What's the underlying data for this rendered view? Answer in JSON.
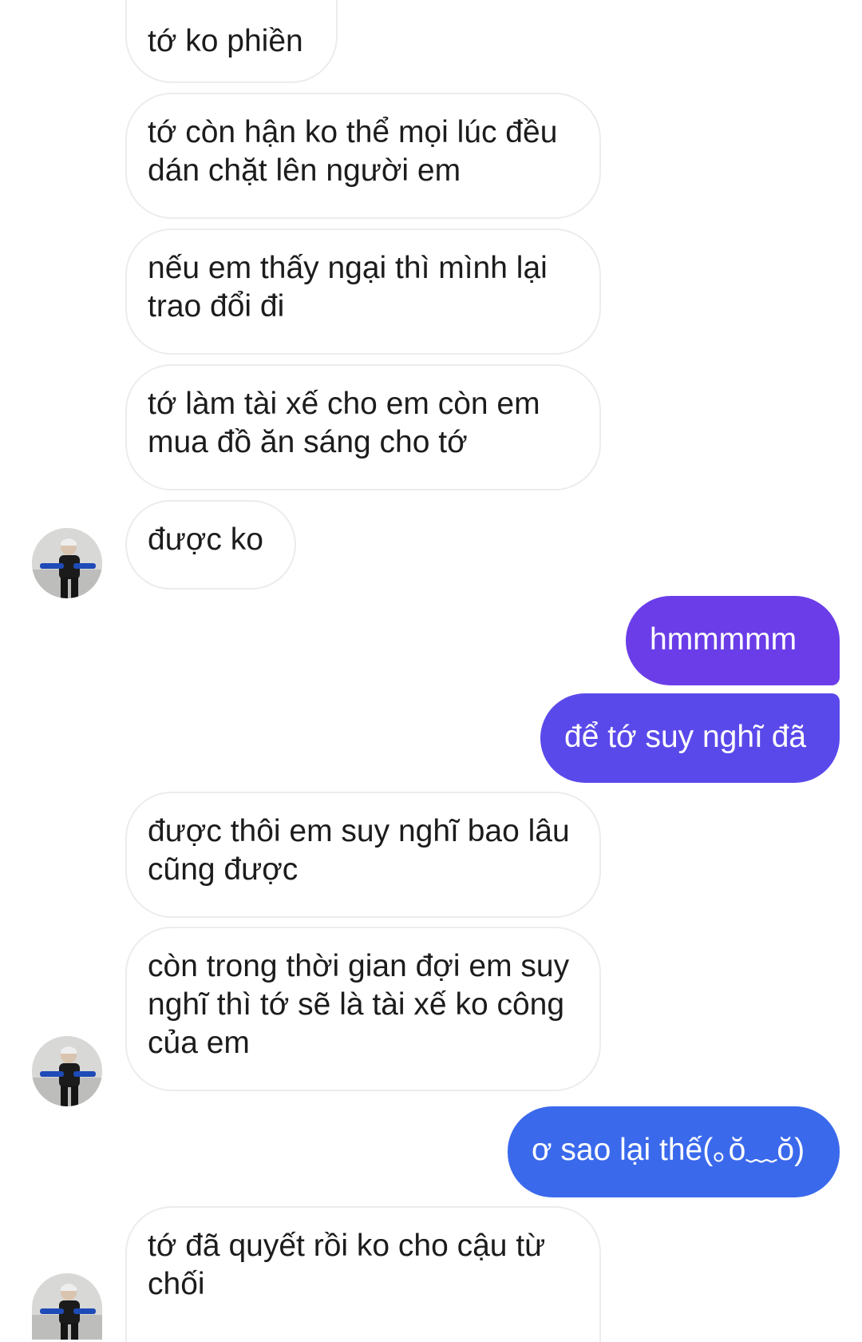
{
  "conversation": {
    "messages": [
      {
        "sender": "other",
        "text": "tớ ko phiền"
      },
      {
        "sender": "other",
        "text": "tớ còn hận ko thể mọi lúc đều dán chặt lên người em"
      },
      {
        "sender": "other",
        "text": "nếu em thấy ngại thì mình lại trao đổi đi"
      },
      {
        "sender": "other",
        "text": "tớ làm tài xế cho em còn em mua đồ ăn sáng cho tớ"
      },
      {
        "sender": "other",
        "text": "được ko"
      },
      {
        "sender": "me",
        "text": "hmmmmm"
      },
      {
        "sender": "me",
        "text": "để tớ suy nghĩ đã"
      },
      {
        "sender": "other",
        "text": "được thôi em suy nghĩ bao lâu cũng được"
      },
      {
        "sender": "other",
        "text": "còn trong thời gian đợi em suy nghĩ thì tớ sẽ là tài xế ko công của em"
      },
      {
        "sender": "me",
        "text": "ơ sao lại thế(｡ŏ﹏ŏ)"
      },
      {
        "sender": "other",
        "text": "tớ đã quyết rồi ko cho cậu từ chối"
      }
    ]
  },
  "colors": {
    "outgoing_top": "#6a3de8",
    "outgoing_mid": "#5a49ea",
    "outgoing_bottom": "#3a69ec",
    "incoming_border": "#ececec",
    "incoming_text": "#1c1c1c"
  },
  "icons": {
    "avatar": "contact-avatar-photo"
  }
}
